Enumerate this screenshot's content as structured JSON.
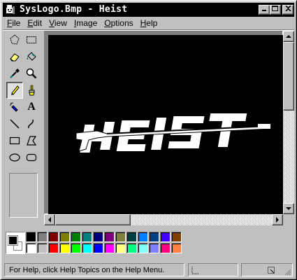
{
  "window": {
    "title": "SysLogo.Bmp - Heist",
    "minimize_label": "_",
    "maximize_label": "□",
    "close_label": "×"
  },
  "menu": [
    {
      "label": "File",
      "accel": "F",
      "rest": "ile"
    },
    {
      "label": "Edit",
      "accel": "E",
      "rest": "dit"
    },
    {
      "label": "View",
      "accel": "V",
      "rest": "iew"
    },
    {
      "label": "Image",
      "accel": "I",
      "rest": "mage"
    },
    {
      "label": "Options",
      "accel": "O",
      "rest": "ptions"
    },
    {
      "label": "Help",
      "accel": "H",
      "rest": "elp"
    }
  ],
  "tools": [
    {
      "name": "free-form-select-icon"
    },
    {
      "name": "select-icon"
    },
    {
      "name": "eraser-icon"
    },
    {
      "name": "fill-with-color-icon"
    },
    {
      "name": "pick-color-icon"
    },
    {
      "name": "magnifier-icon"
    },
    {
      "name": "pencil-icon",
      "selected": true
    },
    {
      "name": "brush-icon"
    },
    {
      "name": "airbrush-icon"
    },
    {
      "name": "text-icon",
      "glyph": "A"
    },
    {
      "name": "line-icon"
    },
    {
      "name": "curve-icon"
    },
    {
      "name": "rectangle-icon"
    },
    {
      "name": "polygon-icon"
    },
    {
      "name": "ellipse-icon"
    },
    {
      "name": "rounded-rectangle-icon"
    }
  ],
  "image": {
    "logo_text": "HEIST",
    "background_color": "#000000",
    "logo_color": "#ffffff"
  },
  "colors": {
    "foreground": "#000000",
    "background": "#ffffff",
    "palette_top": [
      "#000000",
      "#808080",
      "#800000",
      "#808000",
      "#008000",
      "#008080",
      "#000080",
      "#800080",
      "#808040",
      "#004040",
      "#0080ff",
      "#004080",
      "#4000ff",
      "#804000"
    ],
    "palette_bottom": [
      "#ffffff",
      "#c0c0c0",
      "#ff0000",
      "#ffff00",
      "#00ff00",
      "#00ffff",
      "#0000ff",
      "#ff00ff",
      "#ffff80",
      "#00ff80",
      "#80ffff",
      "#8080ff",
      "#ff0080",
      "#ff8040"
    ]
  },
  "status": {
    "help_text": "For Help, click Help Topics on the Help Menu."
  }
}
